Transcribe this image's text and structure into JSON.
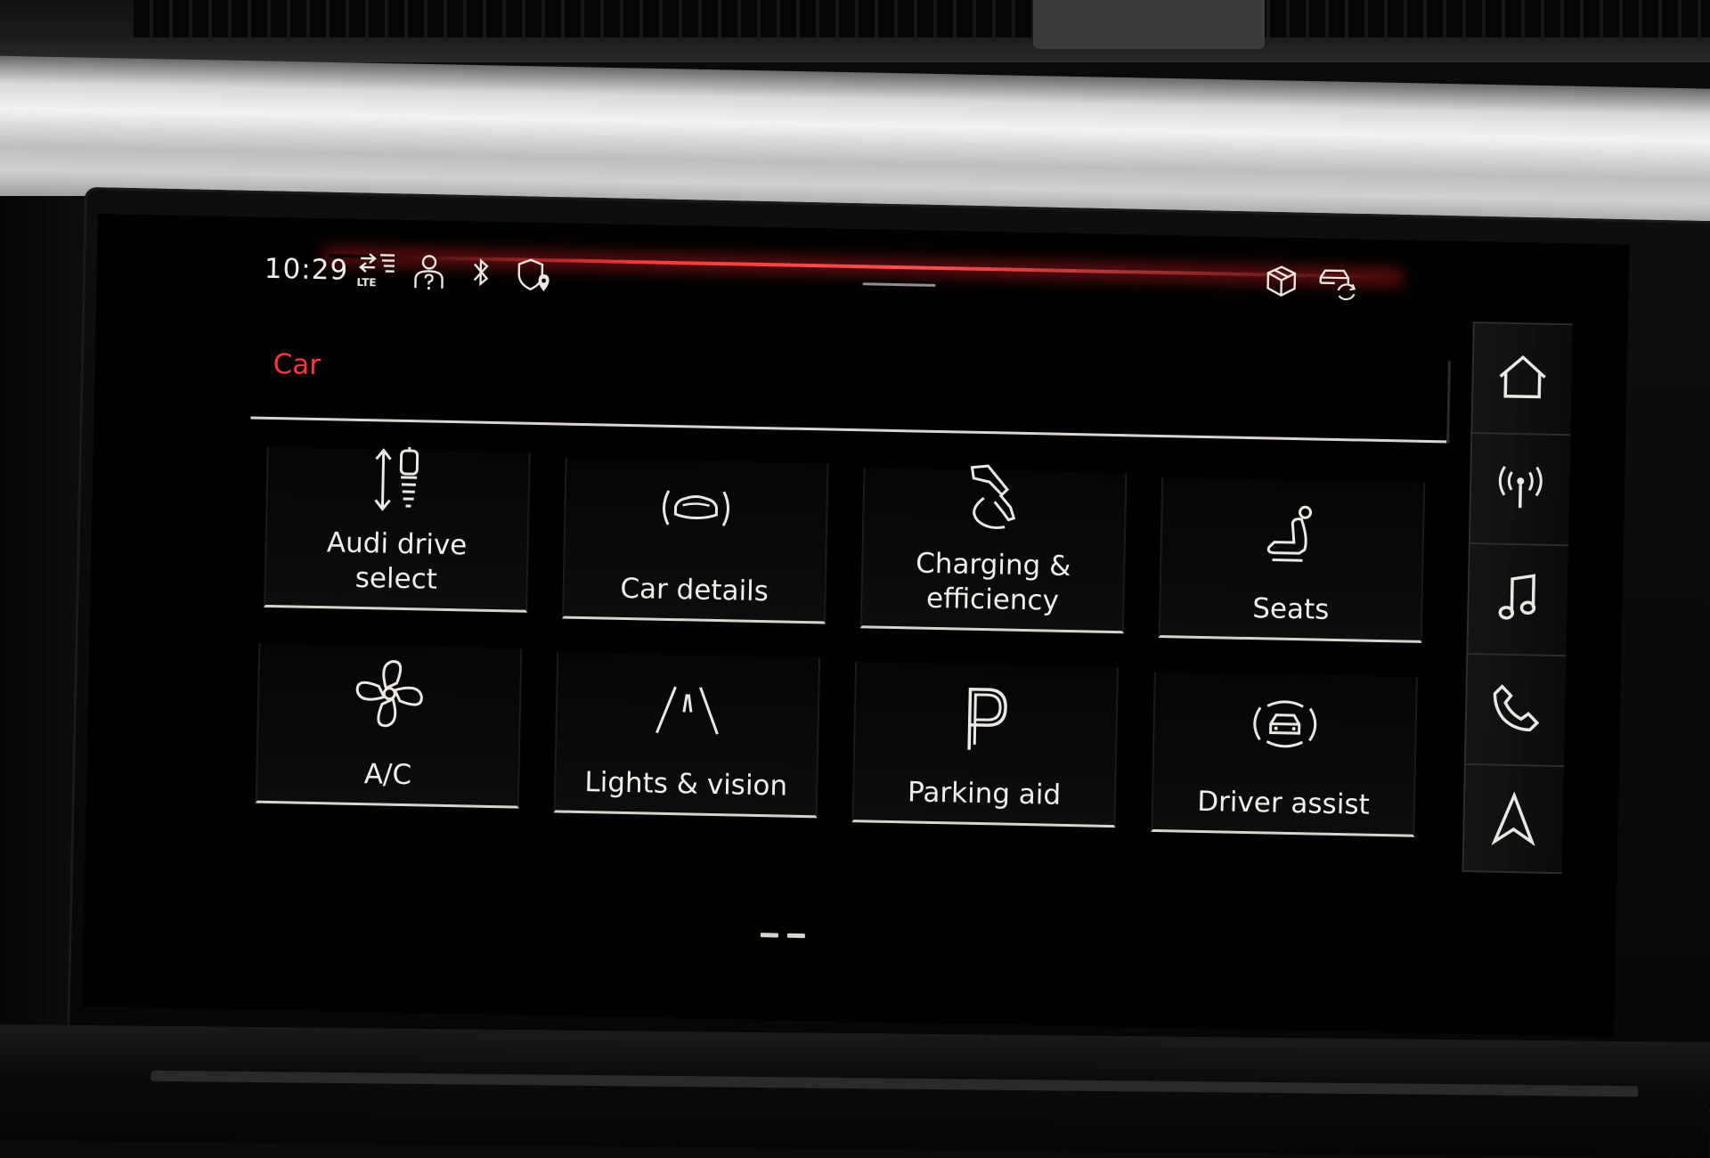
{
  "status_bar": {
    "time": "10:29",
    "network_label": "LTE",
    "icons": [
      "lte-signal-icon",
      "user-help-icon",
      "bluetooth-icon",
      "location-shield-icon",
      "package-icon",
      "car-sync-icon"
    ]
  },
  "header": {
    "title": "Car"
  },
  "tiles": [
    {
      "label_line1": "Audi drive",
      "label_line2": "select",
      "icon": "drive-select-icon"
    },
    {
      "label_line1": "Car details",
      "icon": "car-details-icon"
    },
    {
      "label_line1": "Charging &",
      "label_line2": "efficiency",
      "icon": "charging-plug-icon"
    },
    {
      "label_line1": "Seats",
      "icon": "seat-icon"
    },
    {
      "label_line1": "A/C",
      "icon": "fan-icon"
    },
    {
      "label_line1": "Lights & vision",
      "icon": "road-lights-icon"
    },
    {
      "label_line1": "Parking aid",
      "icon": "parking-icon"
    },
    {
      "label_line1": "Driver assist",
      "icon": "driver-assist-icon"
    }
  ],
  "pager": {
    "pages": 2,
    "current": 1
  },
  "rail": {
    "items": [
      "home-icon",
      "radio-icon",
      "music-icon",
      "phone-icon",
      "navigation-icon"
    ]
  },
  "colors": {
    "accent": "#ff3535",
    "text": "#f2eeea",
    "divider": "#d8d3cd"
  }
}
